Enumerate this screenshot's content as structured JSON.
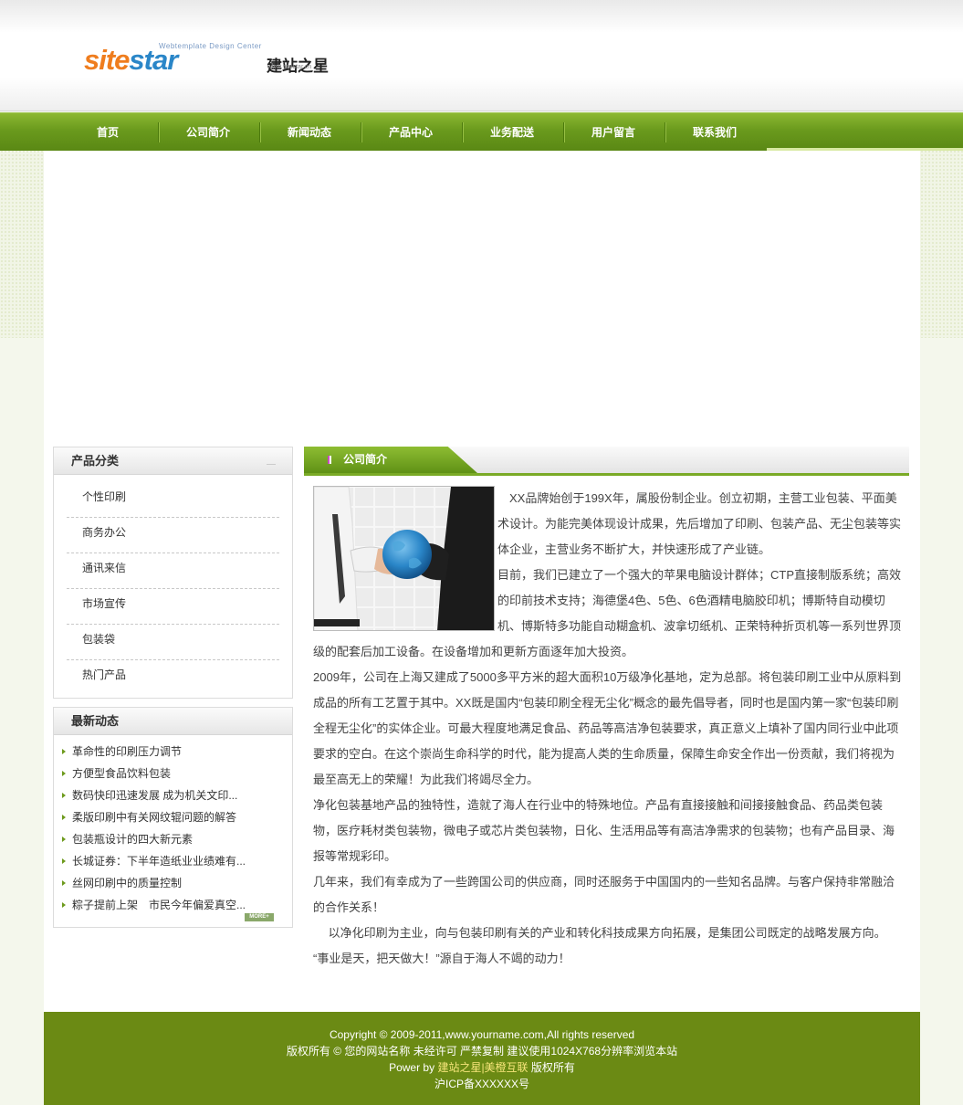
{
  "logo": {
    "tagline": "Webtemplate Design Center",
    "word_part1": "site",
    "word_part2": "star",
    "cn_name": "建站之星",
    "url": "www.sitestar.cn"
  },
  "nav": {
    "items": [
      "首页",
      "公司简介",
      "新闻动态",
      "产品中心",
      "业务配送",
      "用户留言",
      "联系我们"
    ]
  },
  "sidebar": {
    "categories_title": "产品分类",
    "categories": [
      "个性印刷",
      "商务办公",
      "通讯来信",
      "市场宣传",
      "包装袋",
      "热门产品"
    ],
    "news_title": "最新动态",
    "news": [
      "革命性的印刷压力调节",
      "方便型食品饮料包装",
      "数码快印迅速发展 成为机关文印...",
      "柔版印刷中有关网纹辊问题的解答",
      "包装瓶设计的四大新元素",
      "长城证券：下半年造纸业业绩难有...",
      "丝网印刷中的质量控制",
      "粽子提前上架　市民今年偏爱真空..."
    ],
    "more_label": "MORE+"
  },
  "content": {
    "title": "公司简介",
    "paragraphs": [
      "　XX品牌始创于199X年，属股份制企业。创立初期，主营工业包装、平面美术设计。为能完美体现设计成果，先后增加了印刷、包装产品、无尘包装等实体企业，主营业务不断扩大，并快速形成了产业链。",
      "目前，我们已建立了一个强大的苹果电脑设计群体；CTP直接制版系统；高效的印前技术支持；海德堡4色、5色、6色酒精电脑胶印机；博斯特自动模切机、博斯特多功能自动糊盒机、波拿切纸机、正荣特种折页机等一系列世界顶级的配套后加工设备。在设备增加和更新方面逐年加大投资。",
      "2009年，公司在上海又建成了5000多平方米的超大面积10万级净化基地，定为总部。将包装印刷工业中从原料到成品的所有工艺置于其中。XX既是国内“包装印刷全程无尘化”概念的最先倡导者，同时也是国内第一家“包装印刷全程无尘化”的实体企业。可最大程度地满足食品、药品等高洁净包装要求，真正意义上填补了国内同行业中此项要求的空白。在这个崇尚生命科学的时代，能为提高人类的生命质量，保障生命安全作出一份贡献，我们将视为最至高无上的荣耀！为此我们将竭尽全力。",
      "净化包装基地产品的独特性，造就了海人在行业中的特殊地位。产品有直接接触和间接接触食品、药品类包装物，医疗耗材类包装物，微电子或芯片类包装物，日化、生活用品等有高洁净需求的包装物；也有产品目录、海报等常规彩印。",
      "几年来，我们有幸成为了一些跨国公司的供应商，同时还服务于中国国内的一些知名品牌。与客户保持非常融洽的合作关系！",
      "　 以净化印刷为主业，向与包装印刷有关的产业和转化科技成果方向拓展，是集团公司既定的战略发展方向。",
      "“事业是天，把天做大！”源自于海人不竭的动力！"
    ]
  },
  "footer": {
    "line1": "Copyright © 2009-2011,www.yourname.com,All rights reserved",
    "line2": "版权所有 © 您的网站名称 未经许可 严禁复制 建议使用1024X768分辨率浏览本站",
    "power_prefix": "Power by ",
    "power_link": "建站之星|美橙互联",
    "power_suffix": " 版权所有",
    "line4": "沪ICP备XXXXXX号"
  },
  "colors": {
    "nav_green": "#6a9a1d",
    "footer_green": "#6b8a14",
    "link_yellow": "#f6e57a"
  }
}
